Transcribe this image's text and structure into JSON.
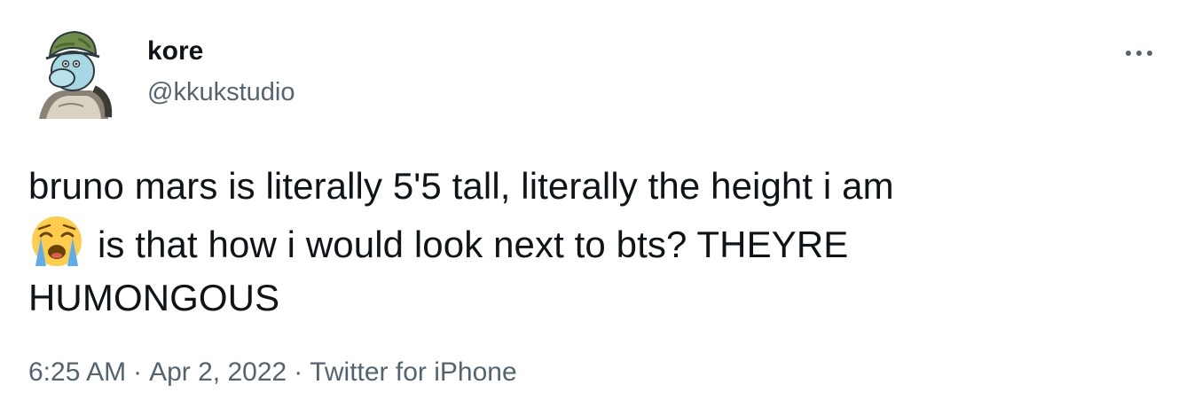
{
  "author": {
    "display_name": "kore",
    "handle": "@kkukstudio",
    "avatar_icon": "cartoon-character-avatar-icon"
  },
  "menu": {
    "icon": "more-options-icon"
  },
  "tweet": {
    "line1": "bruno mars is literally 5'5 tall, literally the height i am",
    "emoji_icon": "loudly-crying-face-emoji",
    "line2": "is that how i would look next to bts?  THEYRE",
    "line3": "HUMONGOUS"
  },
  "meta": {
    "time": "6:25 AM",
    "separator": "·",
    "date": "Apr 2, 2022",
    "source": "Twitter for iPhone"
  },
  "colors": {
    "text_primary": "#0f1419",
    "text_secondary": "#536471",
    "background": "#ffffff"
  }
}
